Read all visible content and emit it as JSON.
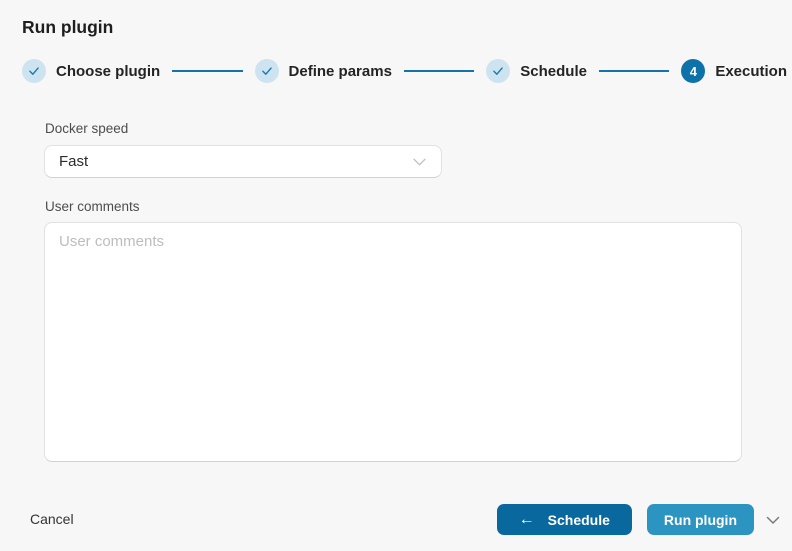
{
  "dialog": {
    "title": "Run plugin"
  },
  "stepper": {
    "steps": [
      {
        "label": "Choose plugin",
        "status": "completed"
      },
      {
        "label": "Define params",
        "status": "completed"
      },
      {
        "label": "Schedule",
        "status": "completed"
      },
      {
        "label": "Execution",
        "status": "current",
        "number": "4"
      }
    ]
  },
  "form": {
    "docker_speed": {
      "label": "Docker speed",
      "value": "Fast"
    },
    "user_comments": {
      "label": "User comments",
      "placeholder": "User comments",
      "value": ""
    }
  },
  "footer": {
    "cancel_label": "Cancel",
    "back_button_label": "Schedule",
    "submit_button_label": "Run plugin"
  },
  "icons": {
    "check": "check-icon",
    "chevron_down": "chevron-down-icon",
    "arrow_left": "←"
  },
  "colors": {
    "background": "#f7f7f7",
    "step_done_circle": "#cde4f0",
    "step_blue": "#1474aa",
    "step_current_circle": "#0e72aa",
    "back_button": "#09689d",
    "primary_button": "#2b94c0",
    "field_border": "#e1e1e1"
  }
}
